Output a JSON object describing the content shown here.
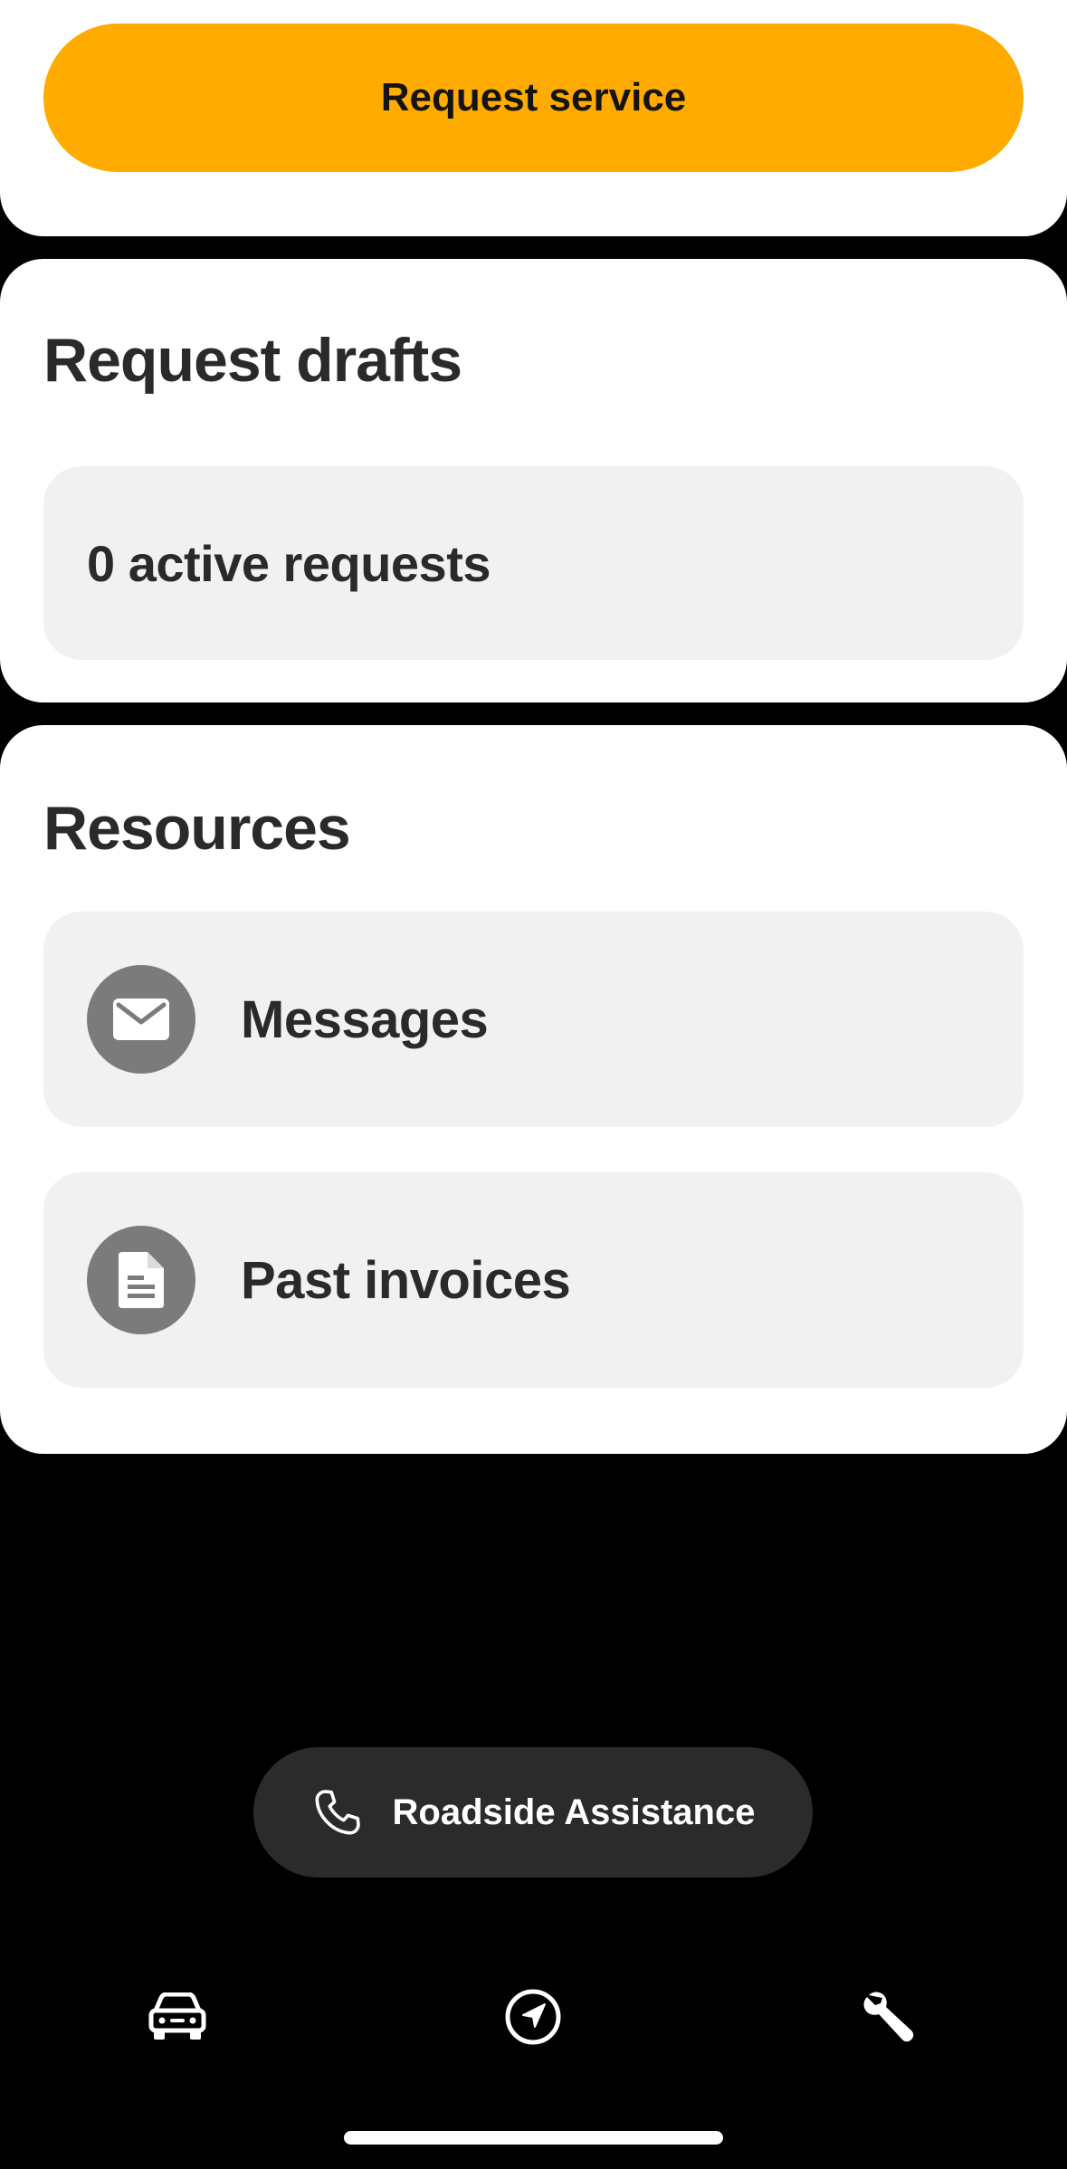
{
  "request_card": {
    "button_label": "Request service",
    "button_color": "#FFAB00"
  },
  "drafts": {
    "title": "Request drafts",
    "status": "0 active requests"
  },
  "resources": {
    "title": "Resources",
    "items": [
      {
        "label": "Messages",
        "icon": "envelope-icon"
      },
      {
        "label": "Past invoices",
        "icon": "document-icon"
      }
    ]
  },
  "roadside": {
    "label": "Roadside Assistance",
    "icon": "phone-icon"
  },
  "tab_bar": {
    "tabs": [
      {
        "icon": "car-icon"
      },
      {
        "icon": "navigation-arrow-icon"
      },
      {
        "icon": "wrench-icon",
        "selected": true
      }
    ]
  },
  "colors": {
    "background": "#000000",
    "card": "#FFFFFF",
    "row": "#F1F1F1",
    "icon_circle": "#7B7B7B",
    "pill": "#2B2B2B"
  }
}
